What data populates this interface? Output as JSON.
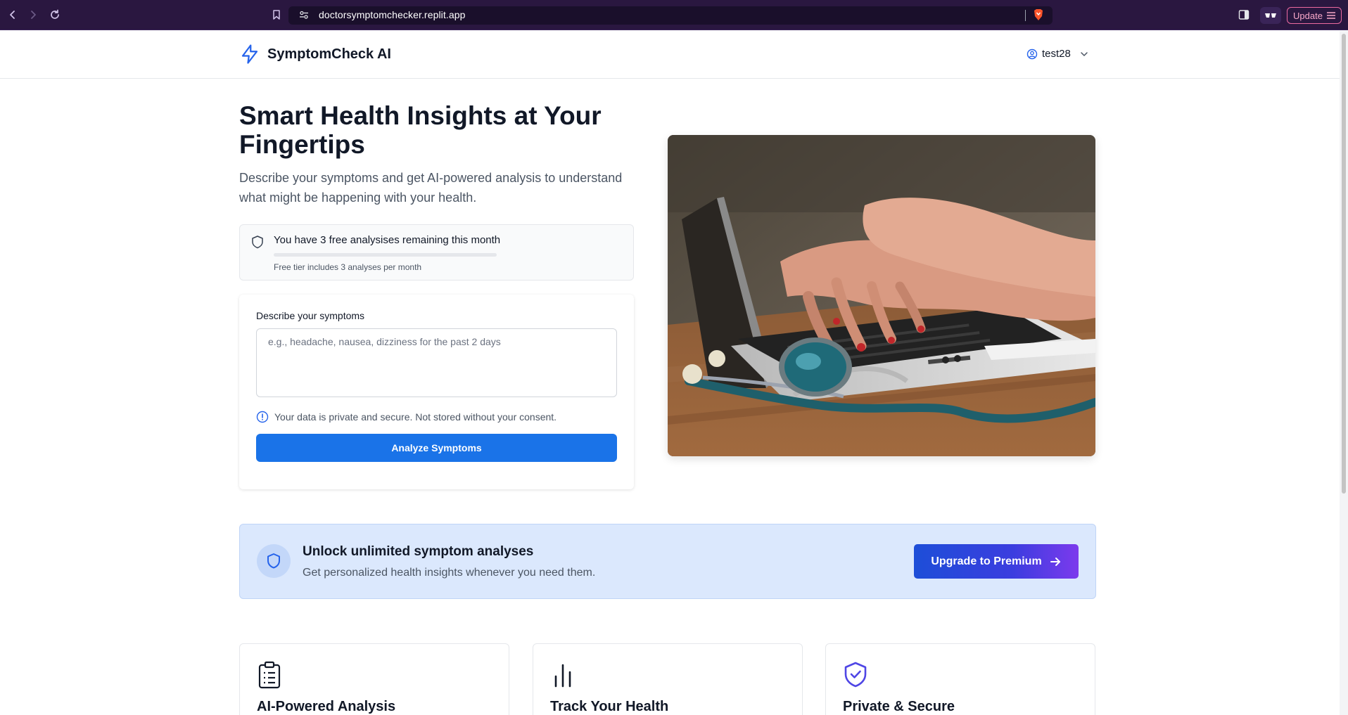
{
  "browser": {
    "url": "doctorsymptomchecker.replit.app",
    "update_label": "Update"
  },
  "header": {
    "brand": "SymptomCheck AI",
    "username": "test28"
  },
  "hero": {
    "title": "Smart Health Insights at Your Fingertips",
    "subtitle": "Describe your symptoms and get AI-powered analysis to understand what might be happening with your health."
  },
  "quota": {
    "message": "You have 3 free analysises remaining this month",
    "note": "Free tier includes 3 analyses per month",
    "used_fraction": 0
  },
  "form": {
    "label": "Describe your symptoms",
    "placeholder": "e.g., headache, nausea, dizziness for the past 2 days",
    "value": "",
    "privacy_note": "Your data is private and secure. Not stored without your consent.",
    "submit_label": "Analyze Symptoms"
  },
  "upgrade": {
    "title": "Unlock unlimited symptom analyses",
    "subtitle": "Get personalized health insights whenever you need them.",
    "button_label": "Upgrade to Premium"
  },
  "features": [
    {
      "title": "AI-Powered Analysis",
      "icon": "clipboard-list-icon"
    },
    {
      "title": "Track Your Health",
      "icon": "bar-chart-icon"
    },
    {
      "title": "Private & Secure",
      "icon": "shield-check-icon"
    }
  ],
  "colors": {
    "browser_bar": "#2a1740",
    "primary": "#1a73e8",
    "brand_icon": "#2563eb",
    "banner_bg": "#dbe8fd",
    "feature_icon_secure": "#4f46e5"
  }
}
